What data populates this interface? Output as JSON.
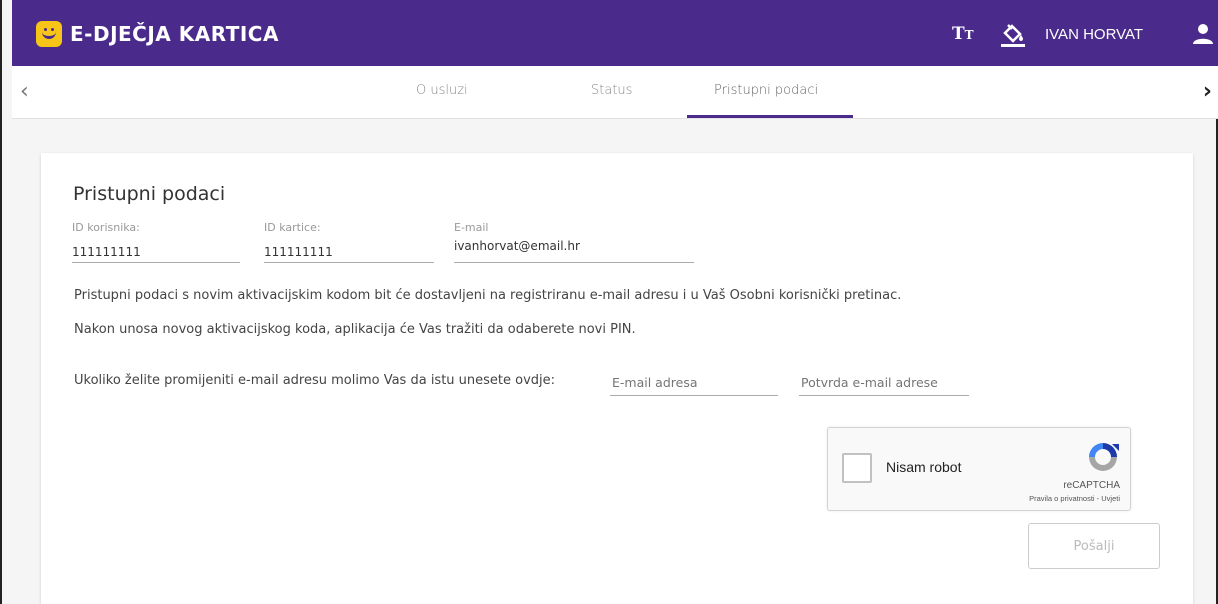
{
  "header": {
    "app_title": "E-DJEČJA KARTICA",
    "text_size_icon": "text-size-icon",
    "theme_icon": "paint-bucket-icon",
    "user_name": "IVAN HORVAT",
    "user_icon": "user-icon",
    "brand_color": "#4a2b8c",
    "logo_color": "#f7c517"
  },
  "tabs": [
    {
      "label": "O usluzi"
    },
    {
      "label": "Status"
    },
    {
      "label": "Pristupni podaci",
      "active": true
    }
  ],
  "nav": {
    "prev": "‹",
    "next": "›"
  },
  "card": {
    "title": "Pristupni podaci",
    "fields": [
      {
        "label": "ID korisnika:",
        "value": "111111111"
      },
      {
        "label": "ID kartice:",
        "value": "111111111"
      },
      {
        "label": "E-mail",
        "value": "ivanhorvat@email.hr"
      }
    ],
    "para1": "Pristupni podaci s novim aktivacijskim kodom bit će dostavljeni na registriranu e-mail adresu i u Vaš Osobni korisnički pretinac.",
    "para2": "Nakon unosa novog aktivacijskog koda, aplikacija će Vas tražiti da odaberete novi PIN.",
    "change_email_prompt": "Ukoliko želite promijeniti e-mail adresu molimo Vas da istu unesete ovdje:",
    "email_placeholder": "E-mail adresa",
    "confirm_placeholder": "Potvrda e-mail adrese",
    "recaptcha": {
      "label": "Nisam robot",
      "brand": "reCAPTCHA",
      "links": "Pravila o privatnosti - Uvjeti"
    },
    "send_button": "Pošalji"
  }
}
